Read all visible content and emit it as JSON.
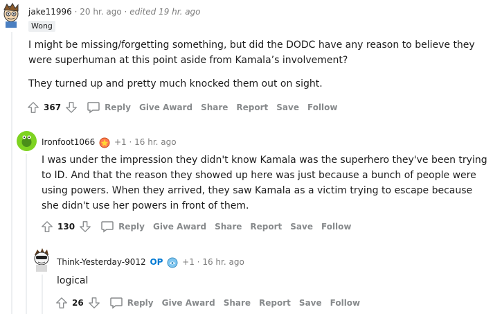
{
  "comments": [
    {
      "author": "jake11996",
      "time": "20 hr. ago",
      "edited": "edited 19 hr. ago",
      "flair": "Wong",
      "body": [
        "I might be missing/forgetting something, but did the DODC have any reason to believe they were superhuman at this point aside from Kamala’s involvement?",
        "They turned up and pretty much knocked them out on sight."
      ],
      "votes": "367"
    },
    {
      "author": "Ironfoot1066",
      "award_count": "+1",
      "time": "16 hr. ago",
      "body": [
        "I was under the impression they didn't know Kamala was the superhero they've been trying to ID. And that the reason they showed up here was just because a bunch of people were using powers. When they arrived, they saw Kamala as a victim trying to escape because she didn't use her powers in front of them."
      ],
      "votes": "130"
    },
    {
      "author": "Think-Yesterday-9012",
      "op_tag": "OP",
      "award_count": "+1",
      "time": "16 hr. ago",
      "body": [
        "logical"
      ],
      "votes": "26"
    }
  ],
  "actions": {
    "reply": "Reply",
    "give_award": "Give Award",
    "share": "Share",
    "report": "Report",
    "save": "Save",
    "follow": "Follow"
  },
  "separator": "·",
  "icons": [
    "upvote-icon",
    "downvote-icon",
    "reply-icon",
    "award-icon"
  ],
  "colors": {
    "op": "#0079d3",
    "meta": "#7c7c7c",
    "action": "#878a8c"
  }
}
